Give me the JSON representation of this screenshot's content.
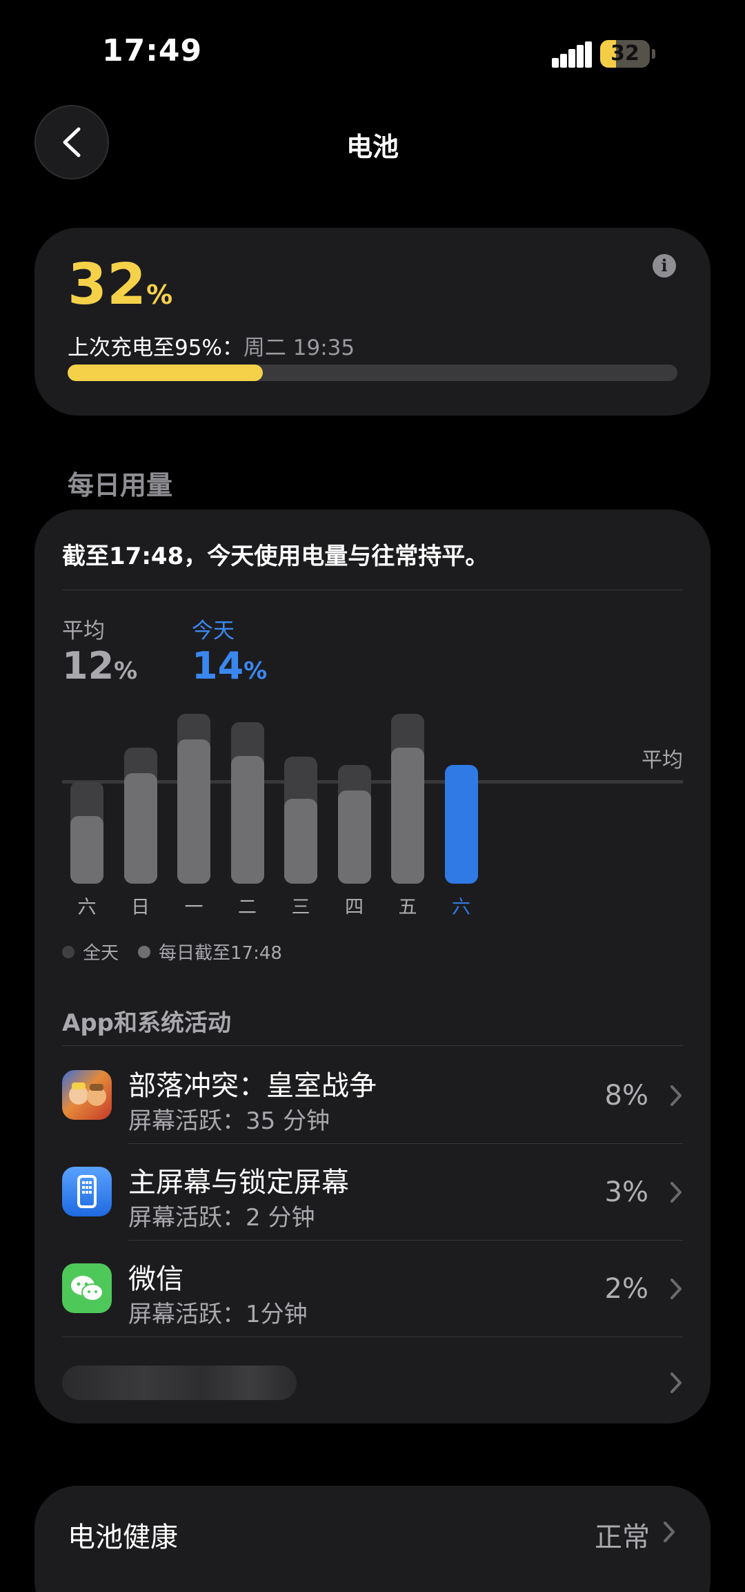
{
  "status_bar": {
    "time": "17:49",
    "battery_level": 32,
    "battery_text": "32"
  },
  "nav": {
    "back": "back",
    "title": "电池"
  },
  "battery": {
    "percent": "32",
    "percent_sign": "%",
    "last_charge_label": "上次充电至95%：",
    "last_charge_time": "周二 19:35",
    "level_fraction": 0.32,
    "accent_color": "#f5d14a"
  },
  "daily_usage": {
    "section_title": "每日用量",
    "summary": "截至17:48，今天使用电量与往常持平。",
    "average_label": "平均",
    "average_value": "12",
    "today_label": "今天",
    "today_value": "14",
    "percent_sign": "%",
    "avg_line_label": "平均",
    "legend": {
      "full_day": "全天",
      "until_now": "每日截至17:48"
    }
  },
  "chart_data": {
    "type": "bar",
    "categories": [
      "六",
      "日",
      "一",
      "二",
      "三",
      "四",
      "五",
      "六"
    ],
    "series": [
      {
        "name": "全天",
        "values": [
          12,
          16,
          20,
          19,
          15,
          14,
          20,
          null
        ]
      },
      {
        "name": "每日截至17:48",
        "values": [
          8,
          13,
          17,
          15,
          10,
          11,
          16,
          14
        ]
      }
    ],
    "ylim": [
      0,
      20
    ],
    "avg_line": 12,
    "today_color": "#2f7ae5"
  },
  "activity": {
    "title": "App和系统活动",
    "apps": [
      {
        "name": "部落冲突：皇室战争",
        "detail": "屏幕活跃：35 分钟",
        "percent": "8%",
        "icon": "clash-royale-icon"
      },
      {
        "name": "主屏幕与锁定屏幕",
        "detail": "屏幕活跃：2 分钟",
        "percent": "3%",
        "icon": "home-lock-screen-icon"
      },
      {
        "name": "微信",
        "detail": "屏幕活跃：1分钟",
        "percent": "2%",
        "icon": "wechat-icon"
      }
    ]
  },
  "health": {
    "label": "电池健康",
    "value": "正常"
  }
}
